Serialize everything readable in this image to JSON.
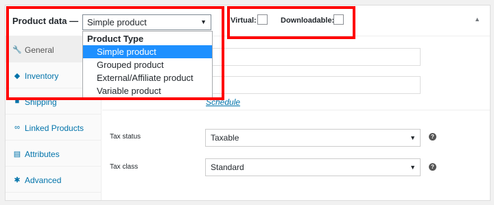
{
  "header": {
    "title": "Product data —",
    "product_type": {
      "selected": "Simple product",
      "caret": "▼"
    },
    "virtual_label": "Virtual:",
    "downloadable_label": "Downloadable:",
    "collapse_glyph": "▲"
  },
  "dropdown": {
    "group_label": "Product Type",
    "options": [
      "Simple product",
      "Grouped product",
      "External/Affiliate product",
      "Variable product"
    ],
    "selected_option": "Simple product"
  },
  "sidebar": {
    "items": [
      {
        "label": "General",
        "icon": "wrench-icon",
        "glyph": "🔧",
        "active": true
      },
      {
        "label": "Inventory",
        "icon": "tag-icon",
        "glyph": "◆"
      },
      {
        "label": "Shipping",
        "icon": "truck-icon",
        "glyph": "■"
      },
      {
        "label": "Linked Products",
        "icon": "link-icon",
        "glyph": "∞"
      },
      {
        "label": "Attributes",
        "icon": "list-icon",
        "glyph": "▤"
      },
      {
        "label": "Advanced",
        "icon": "gear-icon",
        "glyph": "✱"
      }
    ]
  },
  "general": {
    "schedule_link": "Schedule",
    "tax_status": {
      "label": "Tax status",
      "value": "Taxable",
      "caret": "▼"
    },
    "tax_class": {
      "label": "Tax class",
      "value": "Standard",
      "caret": "▼"
    },
    "help_glyph": "?"
  },
  "colors": {
    "accent": "#0073aa",
    "highlight": "#ff0000",
    "selected": "#1e90ff"
  }
}
